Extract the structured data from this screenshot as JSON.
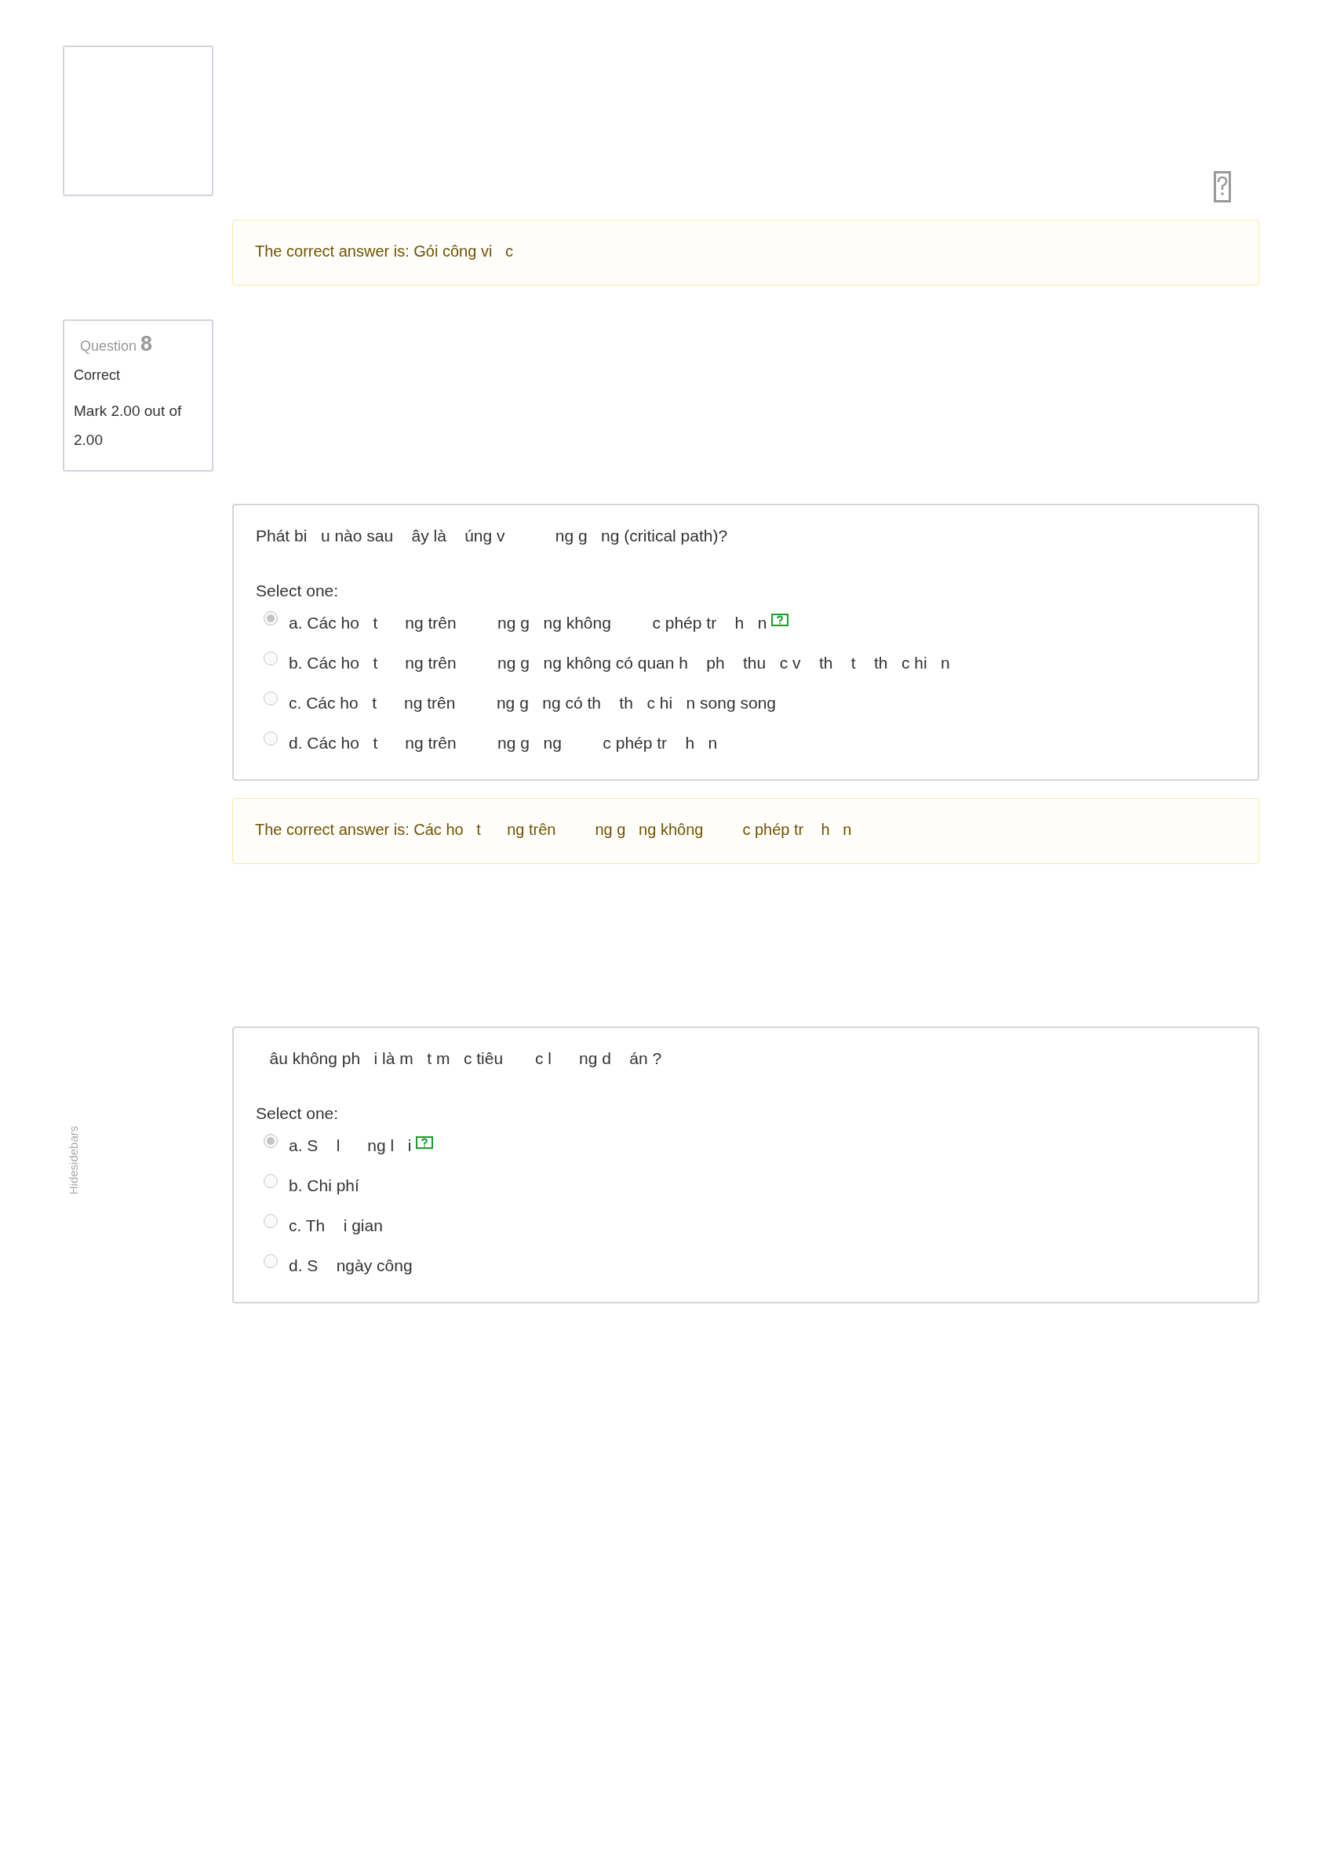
{
  "blocks": [
    {
      "flag_icon": true,
      "feedback": "The correct answer is: Gói công vi   c"
    },
    {
      "info": {
        "label": "Question",
        "number": "8",
        "state": "Correct",
        "mark": "Mark 2.00 out of 2.00"
      },
      "question": {
        "text": "Phát bi   u nào sau    ây là    úng v           ng g   ng (critical path)?",
        "prompt": "Select one:",
        "options": [
          {
            "letter": "a.",
            "text": "Các ho   t      ng trên         ng g   ng không         c phép tr    h   n",
            "selected": true,
            "correct": true
          },
          {
            "letter": "b.",
            "text": "Các ho   t      ng trên         ng g   ng không có quan h    ph    thu   c v    th    t    th   c hi   n",
            "selected": false,
            "correct": false
          },
          {
            "letter": "c.",
            "text": "Các ho   t      ng trên         ng g   ng có th    th   c hi   n song song",
            "selected": false,
            "correct": false
          },
          {
            "letter": "d.",
            "text": "Các ho   t      ng trên         ng g   ng         c phép tr    h   n",
            "selected": false,
            "correct": false
          }
        ]
      },
      "feedback": "The correct answer is: Các ho   t      ng trên         ng g   ng không         c phép tr    h   n"
    },
    {
      "question": {
        "text": "   âu không ph   i là m   t m   c tiêu       c l      ng d    án ?",
        "prompt": "Select one:",
        "options": [
          {
            "letter": "a.",
            "text": "S    l      ng l   i",
            "selected": true,
            "correct": true
          },
          {
            "letter": "b.",
            "text": "Chi phí",
            "selected": false,
            "correct": false
          },
          {
            "letter": "c.",
            "text": "Th    i gian",
            "selected": false,
            "correct": false
          },
          {
            "letter": "d.",
            "text": "S    ngày công",
            "selected": false,
            "correct": false
          }
        ]
      }
    }
  ],
  "sidebar_toggle": "Hidesidebars"
}
